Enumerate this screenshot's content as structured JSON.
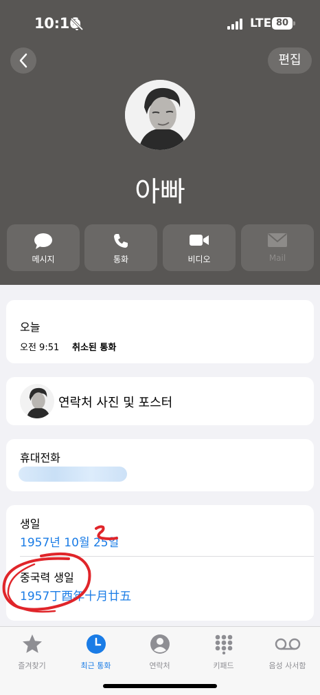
{
  "status": {
    "time": "10:16",
    "network": "LTE",
    "battery": "80"
  },
  "nav": {
    "edit_label": "편집"
  },
  "contact": {
    "name": "아빠"
  },
  "actions": [
    {
      "label": "메시지",
      "icon": "message-icon"
    },
    {
      "label": "통화",
      "icon": "phone-icon"
    },
    {
      "label": "비디오",
      "icon": "video-icon"
    },
    {
      "label": "Mail",
      "icon": "mail-icon"
    }
  ],
  "recent": {
    "day": "오늘",
    "time": "오전 9:51",
    "status": "취소된 통화"
  },
  "poster": {
    "label": "연락처 사진 및 포스터"
  },
  "phone": {
    "label": "휴대전화",
    "value": ""
  },
  "birthday": {
    "label": "생일",
    "value": "1957년 10월 25일",
    "lunar_label": "중국력 생일",
    "lunar_value": "1957丁酉年十月廿五"
  },
  "tabs": [
    {
      "label": "즐겨찾기",
      "icon": "star-icon"
    },
    {
      "label": "최근 통화",
      "icon": "clock-icon",
      "active": true
    },
    {
      "label": "연락처",
      "icon": "person-icon"
    },
    {
      "label": "키패드",
      "icon": "keypad-icon"
    },
    {
      "label": "음성 사서함",
      "icon": "voicemail-icon"
    }
  ],
  "colors": {
    "header_bg": "#585654",
    "accent": "#1a7ce6",
    "annotation": "#e0252a"
  }
}
